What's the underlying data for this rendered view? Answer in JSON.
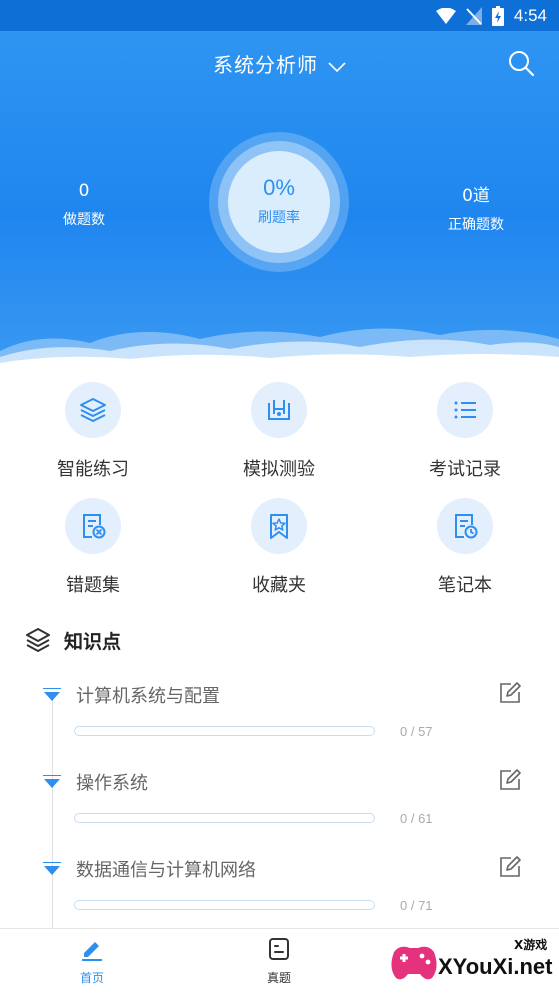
{
  "status_bar": {
    "time": "4:54"
  },
  "header": {
    "subject": "系统分析师",
    "stats": {
      "done_count": "0",
      "done_label": "做题数",
      "rate": "0%",
      "rate_label": "刷题率",
      "correct_count": "0道",
      "correct_label": "正确题数"
    }
  },
  "grid": [
    {
      "label": "智能练习",
      "icon": "layers-icon"
    },
    {
      "label": "模拟测验",
      "icon": "flask-icon"
    },
    {
      "label": "考试记录",
      "icon": "list-icon"
    },
    {
      "label": "错题集",
      "icon": "wrong-doc-icon"
    },
    {
      "label": "收藏夹",
      "icon": "bookmark-star-icon"
    },
    {
      "label": "笔记本",
      "icon": "notebook-clock-icon"
    }
  ],
  "knowledge": {
    "title": "知识点",
    "items": [
      {
        "title": "计算机系统与配置",
        "count": "0 / 57",
        "progress": 0
      },
      {
        "title": "操作系统",
        "count": "0 / 61",
        "progress": 0
      },
      {
        "title": "数据通信与计算机网络",
        "count": "0 / 71",
        "progress": 0
      }
    ]
  },
  "bottom_nav": {
    "items": [
      {
        "label": "首页",
        "icon": "pencil-icon",
        "active": true
      },
      {
        "label": "真题",
        "icon": "exam-icon",
        "active": false
      }
    ]
  },
  "watermark": {
    "text": "XYouXi.net",
    "small": "X游戏"
  },
  "colors": {
    "primary": "#1f86ef",
    "icon_bg": "#e3effc",
    "active_nav": "#2f8ff0"
  }
}
